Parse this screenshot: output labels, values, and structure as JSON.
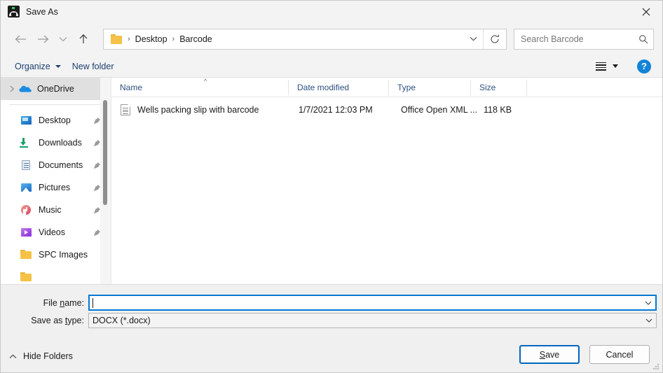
{
  "window": {
    "title": "Save As",
    "app_icon": "spc-app-icon",
    "close_label": "✕"
  },
  "nav": {
    "back_icon": "arrow-left-icon",
    "forward_icon": "arrow-right-icon",
    "recent_icon": "chevron-down-icon",
    "up_icon": "arrow-up-icon",
    "breadcrumb": [
      "Desktop",
      "Barcode"
    ],
    "separator": "›",
    "address_chevron": "chevron-down-icon",
    "refresh_icon": "refresh-icon"
  },
  "search": {
    "placeholder": "Search Barcode",
    "icon": "search-icon"
  },
  "toolbar": {
    "organize_label": "Organize",
    "new_folder_label": "New folder",
    "view_icon": "list-view-icon",
    "view_caret": "chevron-down-icon",
    "help_label": "?"
  },
  "sidebar": {
    "items": [
      {
        "label": "OneDrive",
        "icon": "onedrive-cloud-icon",
        "selected": true,
        "expander": true,
        "pinned": false
      },
      {
        "label": "Desktop",
        "icon": "desktop-icon",
        "selected": false,
        "expander": false,
        "pinned": true
      },
      {
        "label": "Downloads",
        "icon": "downloads-icon",
        "selected": false,
        "expander": false,
        "pinned": true
      },
      {
        "label": "Documents",
        "icon": "documents-icon",
        "selected": false,
        "expander": false,
        "pinned": true
      },
      {
        "label": "Pictures",
        "icon": "pictures-icon",
        "selected": false,
        "expander": false,
        "pinned": true
      },
      {
        "label": "Music",
        "icon": "music-icon",
        "selected": false,
        "expander": false,
        "pinned": true
      },
      {
        "label": "Videos",
        "icon": "videos-icon",
        "selected": false,
        "expander": false,
        "pinned": true
      },
      {
        "label": "SPC Images",
        "icon": "folder-icon",
        "selected": false,
        "expander": false,
        "pinned": false
      }
    ]
  },
  "filelist": {
    "columns": [
      "Name",
      "Date modified",
      "Type",
      "Size"
    ],
    "sort_indicator": "^",
    "rows": [
      {
        "name": "Wells packing slip with barcode",
        "date_modified": "1/7/2021 12:03 PM",
        "type": "Office Open XML ...",
        "size": "118 KB",
        "icon": "document-file-icon"
      }
    ]
  },
  "form": {
    "filename_label_pre": "File ",
    "filename_label_accel": "n",
    "filename_label_post": "ame:",
    "filename_value": "",
    "savetype_label_pre": "Save as ",
    "savetype_label_accel": "t",
    "savetype_label_post": "ype:",
    "savetype_value": "DOCX (*.docx)",
    "dropdown_icon": "chevron-down-icon"
  },
  "footer": {
    "hide_folders_label": "Hide Folders",
    "hide_folders_icon": "chevron-up-icon",
    "save_label_pre": "",
    "save_label_accel": "S",
    "save_label_post": "ave",
    "cancel_label": "Cancel"
  },
  "colors": {
    "accent": "#0067c0",
    "link_text": "#1c3f6e",
    "header_text": "#2b4f7e",
    "window_bg": "#f0f0f0",
    "help_blue": "#1284d8",
    "folder_yellow": "#f5c247"
  }
}
